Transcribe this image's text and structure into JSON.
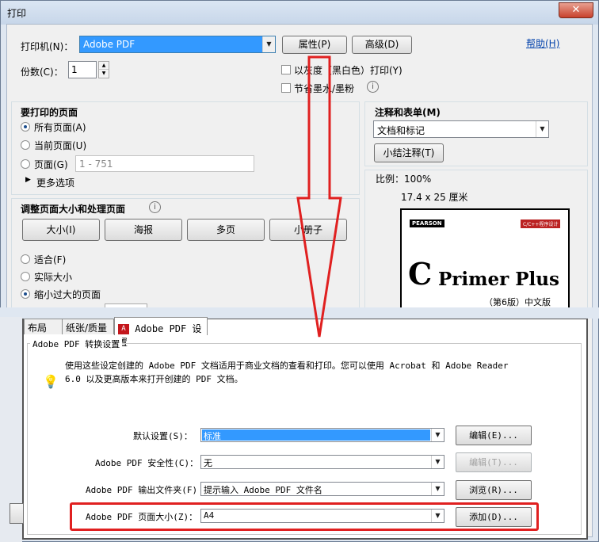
{
  "window": {
    "title": "打印",
    "close_glyph": "✕"
  },
  "printer": {
    "label": "打印机(N)：",
    "selected": "Adobe PDF",
    "properties_btn": "属性(P)",
    "advanced_btn": "高级(D)",
    "help_link": "帮助(H)"
  },
  "copies": {
    "label": "份数(C)：",
    "value": "1"
  },
  "print_options": {
    "grayscale": "以灰度（黑白色）打印(Y)",
    "save_ink": "节省墨水/墨粉"
  },
  "pages": {
    "heading": "要打印的页面",
    "all": "所有页面(A)",
    "current": "当前页面(U)",
    "pages": "页面(G)",
    "range_placeholder": "1 - 751",
    "more": "更多选项"
  },
  "sizing": {
    "heading": "调整页面大小和处理页面",
    "size_btn": "大小(I)",
    "poster_btn": "海报",
    "multiple_btn": "多页",
    "booklet_btn": "小册子",
    "fit": "适合(F)",
    "actual": "实际大小",
    "shrink": "缩小过大的页面"
  },
  "comments": {
    "heading": "注释和表单(M)",
    "selected": "文档和标记",
    "summarize_btn": "小结注释(T)"
  },
  "preview": {
    "scale": "比例：100%",
    "dimensions": "17.4 x 25 厘米",
    "book_publisher": "PEARSON",
    "book_title_c": "C",
    "book_title": "Primer Plus",
    "book_subtitle": "（第6版）中文版",
    "book_series": "C/C++程序设计"
  },
  "pdf_dialog": {
    "tabs": [
      "布局",
      "纸张/质量",
      "Adobe PDF 设置"
    ],
    "group_title": "Adobe PDF 转换设置",
    "description": "使用这些设定创建的 Adobe PDF 文档适用于商业文档的查看和打印。您可以使用 Acrobat 和 Adobe Reader 6.0 以及更高版本来打开创建的 PDF 文档。",
    "rows": [
      {
        "label": "默认设置(S)：",
        "value": "标准",
        "button": "编辑(E)...",
        "enabled": true
      },
      {
        "label": "Adobe PDF 安全性(C)：",
        "value": "无",
        "button": "编辑(T)...",
        "enabled": false
      },
      {
        "label": "Adobe PDF 输出文件夹(F)",
        "value": "提示输入 Adobe PDF 文件名",
        "button": "浏览(R)...",
        "enabled": true
      },
      {
        "label": "Adobe PDF 页面大小(Z)：",
        "value": "A4",
        "button": "添加(D)...",
        "enabled": true
      }
    ]
  },
  "colors": {
    "accent": "#3399ff",
    "highlight_red": "#e02020",
    "selection": "#3399ff"
  }
}
